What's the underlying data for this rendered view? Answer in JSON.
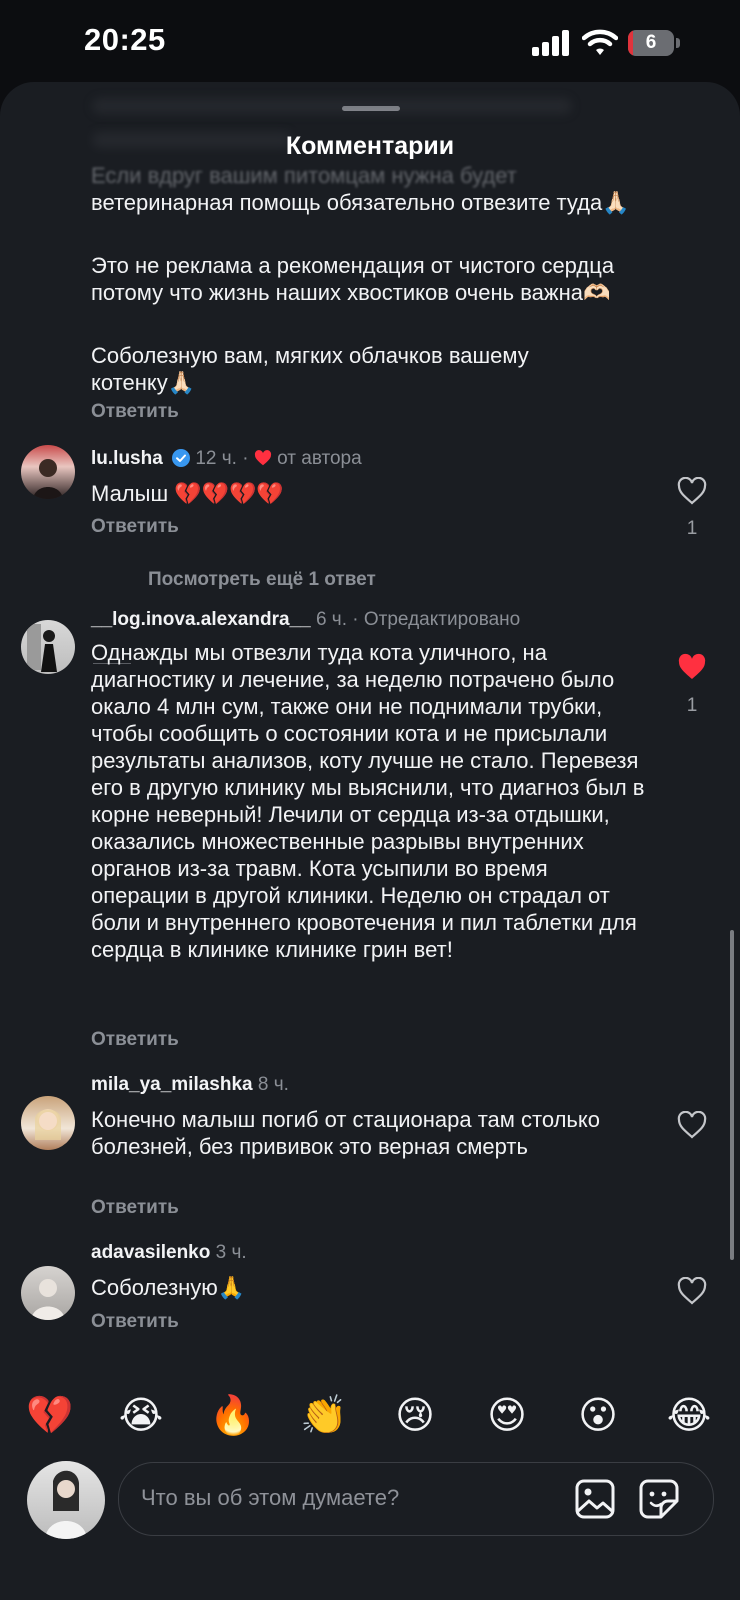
{
  "status_bar": {
    "time": "20:25",
    "battery": "6",
    "battery_level": 0.06
  },
  "sheet": {
    "title": "Комментарии"
  },
  "thread_top": {
    "paragraphs": [
      "Если вдруг вашим питомцам нужна будет ветеринарная помощь обязательно отвезите туда🙏🏻",
      "Это не реклама а рекомендация от чистого сердца потому что жизнь наших хвостиков очень важна🫶🏻",
      "Соболезную вам, мягких облачков вашему котенку🙏🏻"
    ],
    "reply_label": "Ответить"
  },
  "comments": [
    {
      "username": "lu.lusha",
      "verified": true,
      "time": "12 ч.",
      "separator": "·",
      "author_badge": "от автора",
      "text": "Малыш 💔💔💔💔",
      "reply_label": "Ответить",
      "likes": "1",
      "liked": false
    },
    {
      "username": "__log.inova.alexandra__",
      "time": "6 ч.",
      "separator": "·",
      "edited": "Отредактировано",
      "text": "Однажды мы отвезли туда кота уличного, на диагностику и лечение, за неделю потрачено было окало 4 млн сум, также они не поднимали трубки, чтобы сообщить о состоянии кота и не присылали результаты анализов, коту лучше не стало. Перевезя его в другую клинику мы выяснили, что диагноз был в корне неверный! Лечили от сердца из-за отдышки, оказались множественные разрывы внутренних органов из-за травм. Кота усыпили во время операции в другой клиники. Неделю он страдал от боли и внутреннего кровотечения и пил таблетки для сердца в клинике клинике грин вет!",
      "reply_label": "Ответить",
      "likes": "1",
      "liked": true
    },
    {
      "username": "mila_ya_milashka",
      "time": "8 ч.",
      "text": "Конечно малыш погиб от стационара там столько болезней, без прививок это верная смерть",
      "reply_label": "Ответить",
      "liked": false
    },
    {
      "username": "adavasilenko",
      "time": "3 ч.",
      "text": "Соболезную🙏",
      "reply_label": "Ответить",
      "liked": false
    }
  ],
  "view_more_replies": "Посмотреть ещё 1 ответ",
  "quick_reactions": [
    "💔",
    "😭",
    "🔥",
    "👏",
    "😢",
    "😍",
    "😮",
    "😂"
  ],
  "composer": {
    "placeholder": "Что вы об этом думаете?",
    "icons": [
      "image-icon",
      "sticker-icon"
    ]
  },
  "colors": {
    "like_red": "#ff3040",
    "verified_blue": "#3897f0",
    "sheet_bg": "#1a1d22"
  }
}
